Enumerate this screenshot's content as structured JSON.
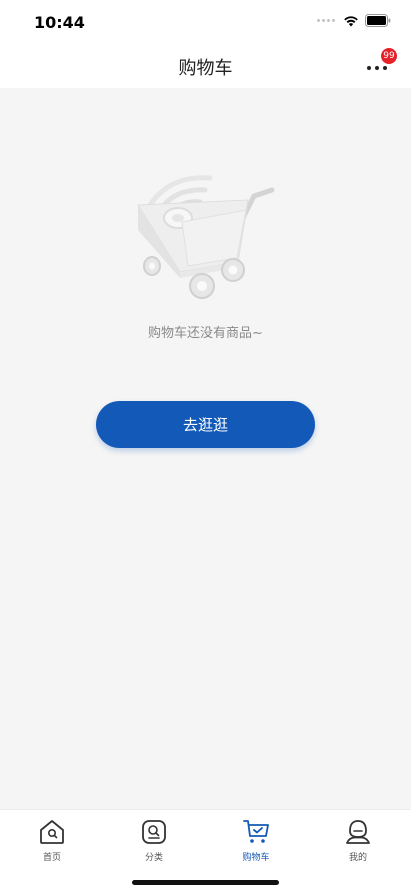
{
  "status_bar": {
    "time": "10:44"
  },
  "header": {
    "title": "购物车",
    "more_badge": "99"
  },
  "empty_state": {
    "message": "购物车还没有商品~",
    "button_label": "去逛逛"
  },
  "tab_bar": {
    "items": [
      {
        "label": "首页",
        "icon": "home-icon"
      },
      {
        "label": "分类",
        "icon": "category-search-icon"
      },
      {
        "label": "购物车",
        "icon": "cart-icon",
        "active": true
      },
      {
        "label": "我的",
        "icon": "user-icon"
      }
    ]
  },
  "colors": {
    "accent": "#1359b8",
    "badge": "#e5212a",
    "background": "#f5f5f5"
  }
}
